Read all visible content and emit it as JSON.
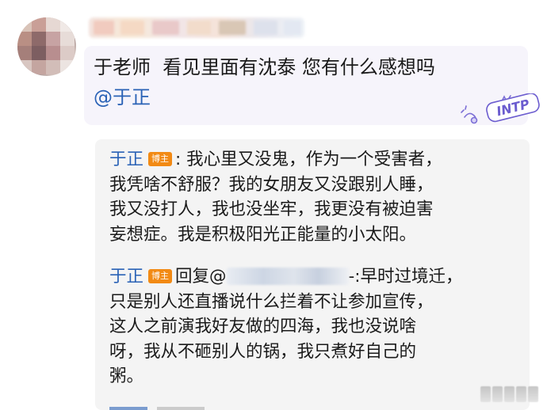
{
  "comment": {
    "text": "于老师  看见里面有沈泰 您有什么感想吗",
    "mention": "@于正"
  },
  "sticker": {
    "label": "INTP"
  },
  "replies": [
    {
      "author": "于正",
      "badge": "博主",
      "lines": [
        ": 我心里又没鬼，作为一个受害者，",
        "我凭啥不舒服？我的女朋友又没跟别人睡，",
        "我又没打人，我也没坐牢，我更没有被迫害",
        "妄想症。我是积极阳光正能量的小太阳。"
      ]
    },
    {
      "author": "于正",
      "badge": "博主",
      "reply_prefix": "回复@",
      "reply_suffix": "-:早时过境迁，",
      "lines": [
        "只是别人还直播说什么拦着不让参加宣传，",
        "这人之前演我好友做的四海，我也没说啥",
        "呀，我从不砸别人的锅，我只煮好自己的",
        "粥。"
      ]
    }
  ],
  "colors": {
    "link": "#2a62b6",
    "badge": "#f28a14",
    "bubble": "#f6f4fb",
    "reply_box": "#f4f4f4"
  }
}
